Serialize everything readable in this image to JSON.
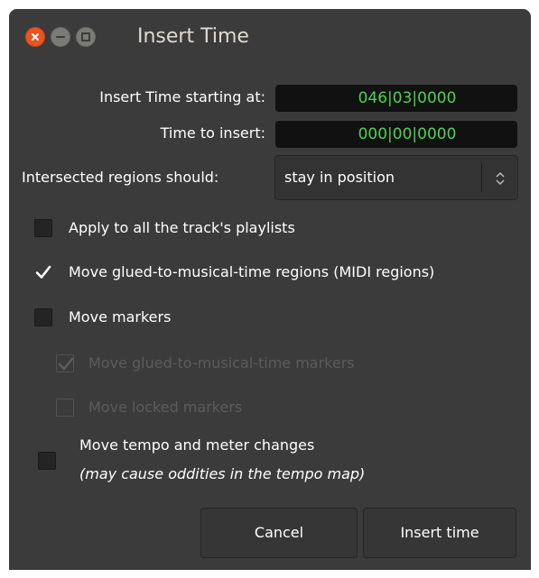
{
  "window": {
    "title": "Insert Time"
  },
  "fields": {
    "start_label": "Insert Time starting at:",
    "start_value": "046|03|0000",
    "insert_label": "Time to insert:",
    "insert_value": "000|00|0000",
    "intersect_label": "Intersected regions should:",
    "intersect_value": "stay in position"
  },
  "options": {
    "all_playlists": {
      "label": "Apply to all the track's playlists",
      "checked": false,
      "enabled": true
    },
    "glued_regions": {
      "label": "Move glued-to-musical-time regions (MIDI regions)",
      "checked": true,
      "enabled": true
    },
    "move_markers": {
      "label": "Move markers",
      "checked": false,
      "enabled": true
    },
    "glued_markers": {
      "label": "Move glued-to-musical-time markers",
      "checked": true,
      "enabled": false
    },
    "locked_markers": {
      "label": "Move locked markers",
      "checked": false,
      "enabled": false
    },
    "tempo_changes": {
      "label": "Move tempo and meter changes",
      "note": "(may cause oddities in the tempo map)",
      "checked": false,
      "enabled": true
    }
  },
  "buttons": {
    "cancel": "Cancel",
    "insert": "Insert time"
  },
  "colors": {
    "window_bg": "#3b3b3b",
    "clock_fg": "#4fd34f",
    "close_button": "#e95420"
  }
}
